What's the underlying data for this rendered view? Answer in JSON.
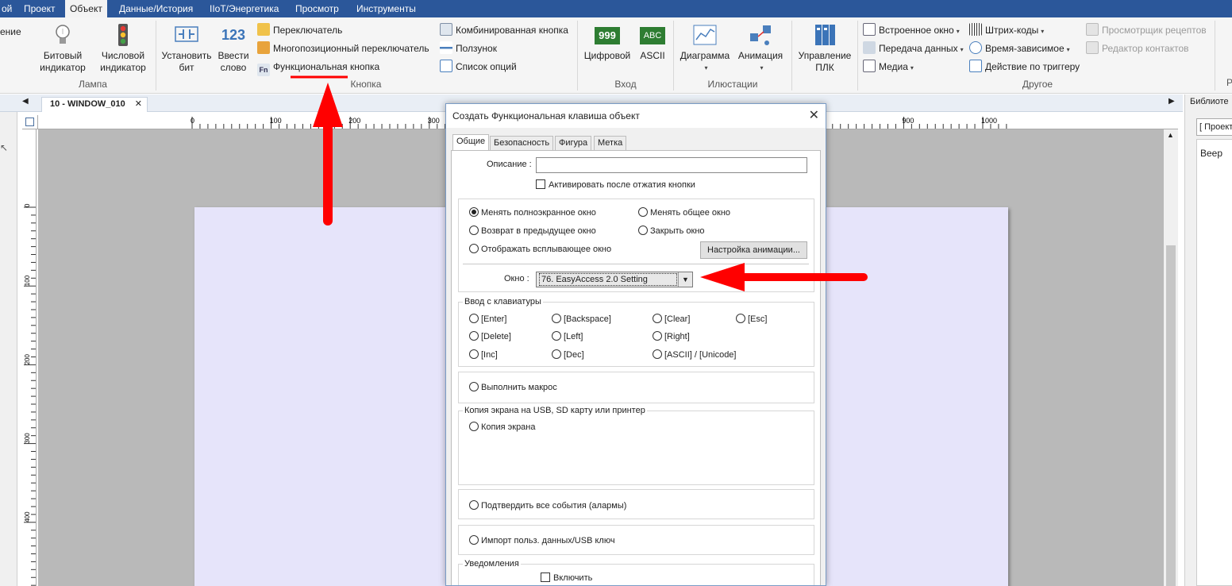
{
  "menubar": {
    "items": [
      "ой",
      "Проект",
      "Объект",
      "Данные/История",
      "IIoT/Энергетика",
      "Просмотр",
      "Инструменты"
    ],
    "active_index": 2
  },
  "ribbon": {
    "cut_left": "ение",
    "bit_indicator": "Битовый индикатор",
    "num_indicator": "Числовой индикатор",
    "group_lamp": "Лампа",
    "set_bit": "Установить бит",
    "set_word": "Ввести слово",
    "switch": "Переключатель",
    "multistate_switch": "Многопозиционный переключатель",
    "function_key": "Функциональная кнопка",
    "combo_button": "Комбинированная кнопка",
    "slider": "Ползунок",
    "option_list": "Список опций",
    "group_button": "Кнопка",
    "numeric": "Цифровой",
    "ascii": "ASCII",
    "group_input": "Вход",
    "chart": "Диаграмма",
    "animation": "Анимация",
    "group_illustrations": "Илюстации",
    "plc_control": "Управление ПЛК",
    "embedded_window": "Встроенное окно",
    "data_transfer": "Передача данных",
    "media": "Медиа",
    "barcodes": "Штрих-коды",
    "time_dependent": "Время-зависимое",
    "trigger_action": "Действие по триггеру",
    "recipe_viewer": "Просмотрщик рецептов",
    "contact_editor": "Редактор контактов",
    "group_other": "Другое",
    "cut_right": "Р"
  },
  "icons": {
    "999": "999",
    "abc": "ABC",
    "123": "123",
    "fn": "Fn"
  },
  "doc_tab": {
    "label": "10 - WINDOW_010",
    "close": "✕"
  },
  "ruler": {
    "h_labels": [
      "0",
      "100",
      "200",
      "300",
      "900",
      "1000"
    ],
    "v_labels": [
      "0",
      "100",
      "200",
      "300",
      "400"
    ]
  },
  "right_panel": {
    "title": "Библиоте",
    "combo": "[ Проект",
    "item": "Beep"
  },
  "dialog": {
    "title": "Создать Функциональная клавиша объект",
    "close": "✕",
    "tabs": [
      "Общие",
      "Безопасность",
      "Фигура",
      "Метка"
    ],
    "description_label": "Описание :",
    "activate_on_release": "Активировать после отжатия кнопки",
    "change_full_window": "Менять полноэкранное окно",
    "change_common_window": "Менять общее окно",
    "return_prev_window": "Возврат в предыдущее окно",
    "close_window": "Закрыть окно",
    "show_popup": "Отображать всплывающее окно",
    "animation_settings": "Настройка анимации...",
    "window_label": "Окно :",
    "window_value": "76. EasyAccess 2.0 Setting",
    "keyboard_group": "Ввод с клавиатуры",
    "keys": [
      "[Enter]",
      "[Backspace]",
      "[Clear]",
      "[Esc]",
      "[Delete]",
      "[Left]",
      "[Right]",
      "[Inc]",
      "[Dec]",
      "[ASCII] / [Unicode]"
    ],
    "run_macro": "Выполнить макрос",
    "screenshot_group": "Копия экрана на USB, SD карту или принтер",
    "screenshot": "Копия экрана",
    "ack_all_alarms": "Подтвердить все события (алармы)",
    "import_user_data": "Импорт польз. данных/USB ключ",
    "notifications_group": "Уведомления",
    "enable": "Включить"
  },
  "colors": {
    "menubar": "#2b579a",
    "annotation_arrow": "#ff0000",
    "canvas_window": "#e6e4fa"
  }
}
